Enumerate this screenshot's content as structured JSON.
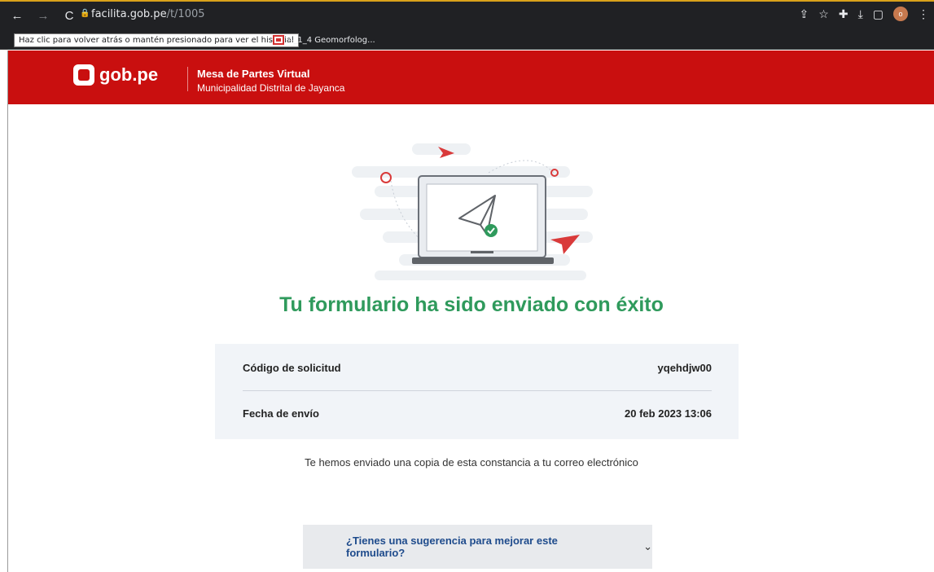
{
  "browser": {
    "url_domain": "facilita.gob.pe",
    "url_path": "/t/1005",
    "tooltip": "Haz clic para volver atrás o mantén presionado para ver el historial",
    "bookmark": "4_1_4 Geomorfolog...",
    "profile_initial": "o"
  },
  "header": {
    "logo_text": "gob.pe",
    "title": "Mesa de Partes Virtual",
    "subtitle": "Municipalidad Distrital de Jayanca",
    "bg_color": "#c90f0f"
  },
  "main": {
    "success_title": "Tu formulario ha sido enviado con éxito",
    "rows": [
      {
        "label": "Código de solicitud",
        "value": "yqehdjw00"
      },
      {
        "label": "Fecha de envío",
        "value": "20 feb 2023 13:06"
      }
    ],
    "note": "Te hemos enviado una copia de esta constancia a tu correo electrónico",
    "suggestion": "¿Tienes una sugerencia para mejorar este formulario?",
    "accent_color": "#2f9a5c"
  }
}
